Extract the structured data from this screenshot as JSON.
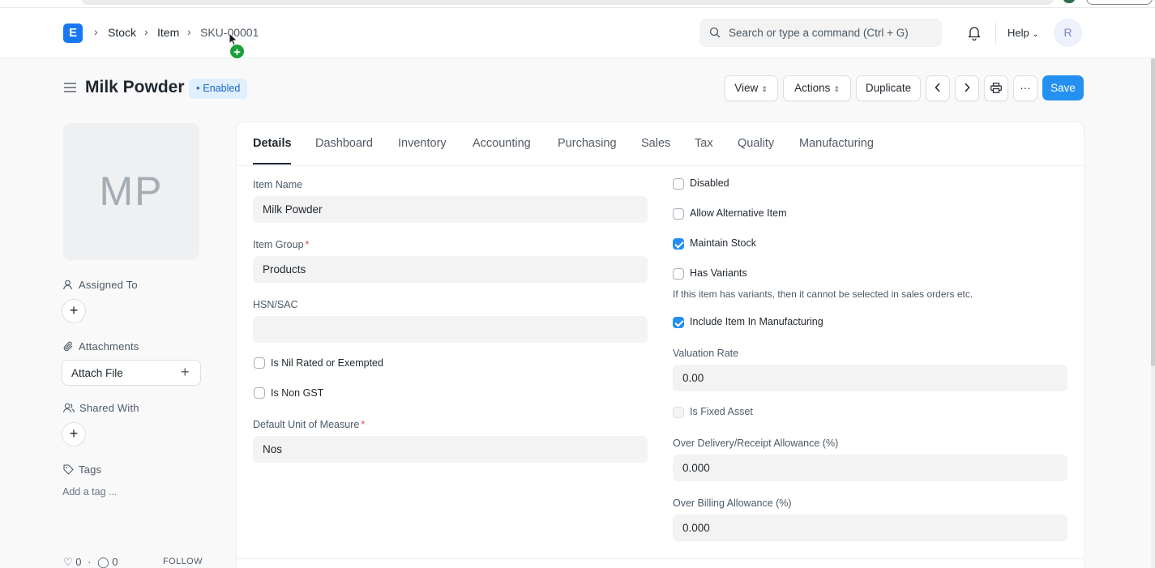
{
  "breadcrumbs": [
    "Stock",
    "Item",
    "SKU-00001"
  ],
  "logo": "E",
  "search": {
    "placeholder": "Search or type a command (Ctrl + G)"
  },
  "help_label": "Help",
  "user_initial": "R",
  "title": "Milk Powder",
  "status": "Enabled",
  "toolbar": {
    "view": "View",
    "actions": "Actions",
    "duplicate": "Duplicate",
    "more": "···",
    "save": "Save"
  },
  "sidebar": {
    "avatar_initials": "MP",
    "assigned_to": "Assigned To",
    "attachments": "Attachments",
    "attach_file": "Attach File",
    "shared_with": "Shared With",
    "tags": "Tags",
    "add_tag": "Add a tag ...",
    "likes": "0",
    "comments": "0",
    "follow": "FOLLOW"
  },
  "tabs": [
    "Details",
    "Dashboard",
    "Inventory",
    "Accounting",
    "Purchasing",
    "Sales",
    "Tax",
    "Quality",
    "Manufacturing"
  ],
  "left_fields": {
    "item_name": {
      "label": "Item Name",
      "value": "Milk Powder"
    },
    "item_group": {
      "label": "Item Group",
      "value": "Products"
    },
    "hsn": {
      "label": "HSN/SAC",
      "value": ""
    },
    "nil_rated": {
      "label": "Is Nil Rated or Exempted",
      "checked": false
    },
    "non_gst": {
      "label": "Is Non GST",
      "checked": false
    },
    "uom": {
      "label": "Default Unit of Measure",
      "value": "Nos"
    }
  },
  "right_fields": {
    "disabled": {
      "label": "Disabled",
      "checked": false
    },
    "allow_alt": {
      "label": "Allow Alternative Item",
      "checked": false
    },
    "maintain_stock": {
      "label": "Maintain Stock",
      "checked": true
    },
    "has_variants": {
      "label": "Has Variants",
      "checked": false
    },
    "variants_desc": "If this item has variants, then it cannot be selected in sales orders etc.",
    "include_mfg": {
      "label": "Include Item In Manufacturing",
      "checked": true
    },
    "valuation_rate": {
      "label": "Valuation Rate",
      "value": "0.00"
    },
    "fixed_asset": {
      "label": "Is Fixed Asset",
      "checked": false
    },
    "over_delivery": {
      "label": "Over Delivery/Receipt Allowance (%)",
      "value": "0.000"
    },
    "over_billing": {
      "label": "Over Billing Allowance (%)",
      "value": "0.000"
    }
  },
  "colors": {
    "primary": "#2490ef",
    "badge_bg": "#e0efff",
    "badge_text": "#1566c0"
  }
}
